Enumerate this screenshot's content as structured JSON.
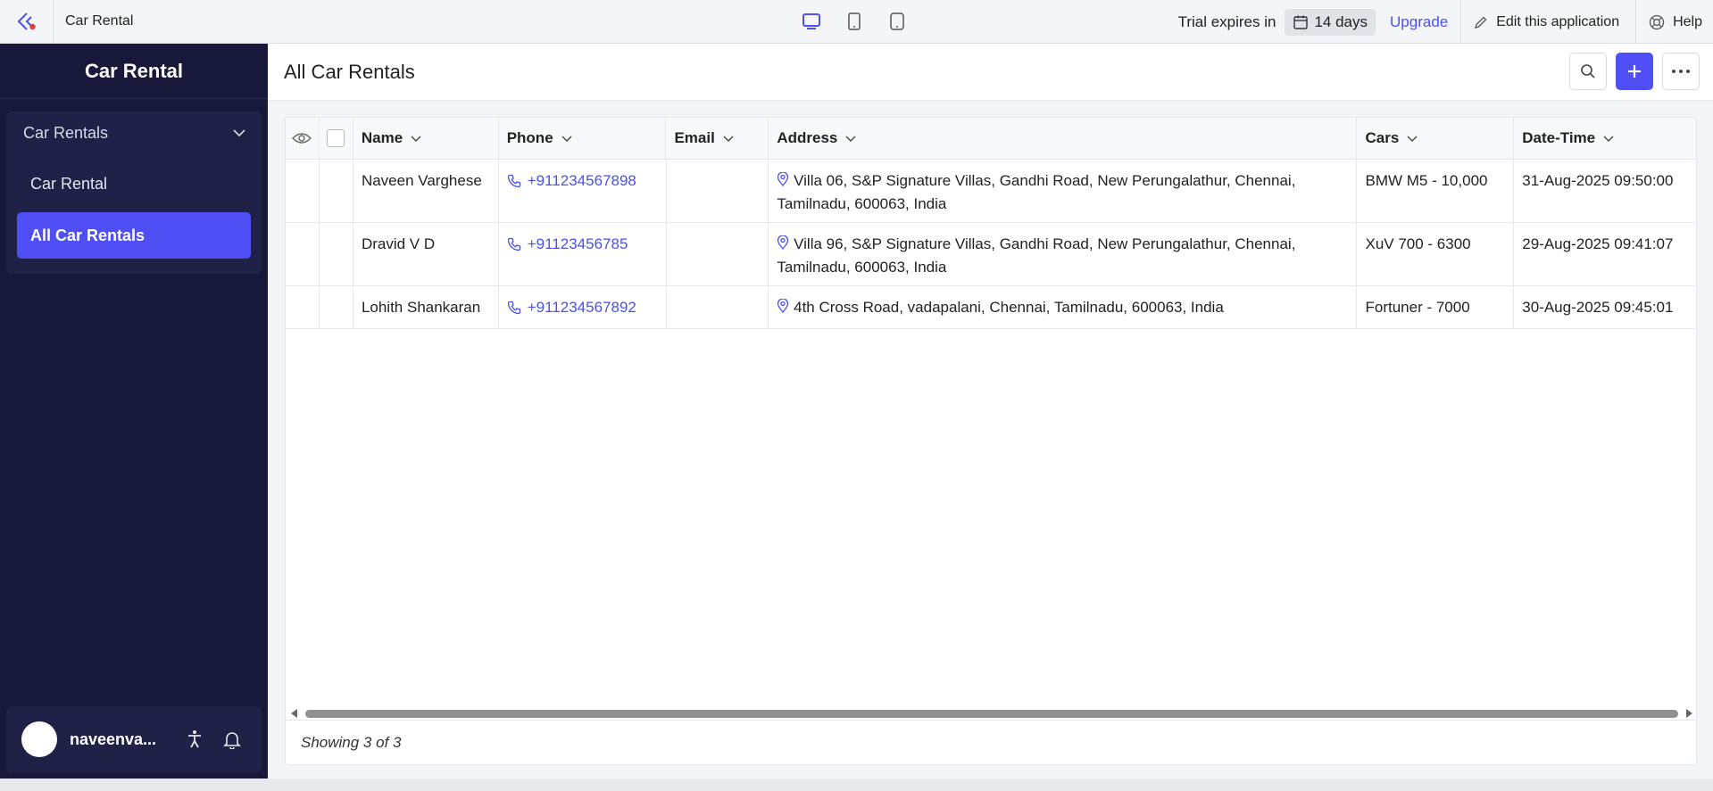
{
  "topbar": {
    "app_title": "Car Rental",
    "trial_label": "Trial expires in",
    "trial_days": "14 days",
    "upgrade": "Upgrade",
    "edit_app": "Edit this application",
    "help": "Help",
    "accent_color": "#4a50ef"
  },
  "sidebar": {
    "brand": "Car Rental",
    "group_label": "Car Rentals",
    "items": [
      {
        "label": "Car Rental",
        "active": false
      },
      {
        "label": "All Car Rentals",
        "active": true
      }
    ],
    "user_name": "naveenva..."
  },
  "main": {
    "title": "All Car Rentals",
    "columns": [
      "Name",
      "Phone",
      "Email",
      "Address",
      "Cars",
      "Date-Time"
    ],
    "rows": [
      {
        "name": "Naveen Varghese",
        "phone": "+911234567898",
        "email": "",
        "address": "Villa 06, S&P Signature Villas, Gandhi Road, New Perungalathur, Chennai, Tamilnadu, 600063, India",
        "cars": "BMW M5 - 10,000",
        "datetime": "31-Aug-2025 09:50:00"
      },
      {
        "name": "Dravid V D",
        "phone": "+91123456785",
        "email": "",
        "address": "Villa 96, S&P Signature Villas, Gandhi Road, New Perungalathur, Chennai, Tamilnadu, 600063, India",
        "cars": "XuV 700 - 6300",
        "datetime": "29-Aug-2025 09:41:07"
      },
      {
        "name": "Lohith Shankaran",
        "phone": "+911234567892",
        "email": "",
        "address": "4th Cross Road, vadapalani, Chennai, Tamilnadu, 600063, India",
        "cars": "Fortuner - 7000",
        "datetime": "30-Aug-2025 09:45:01"
      }
    ],
    "footer": "Showing 3 of 3"
  }
}
